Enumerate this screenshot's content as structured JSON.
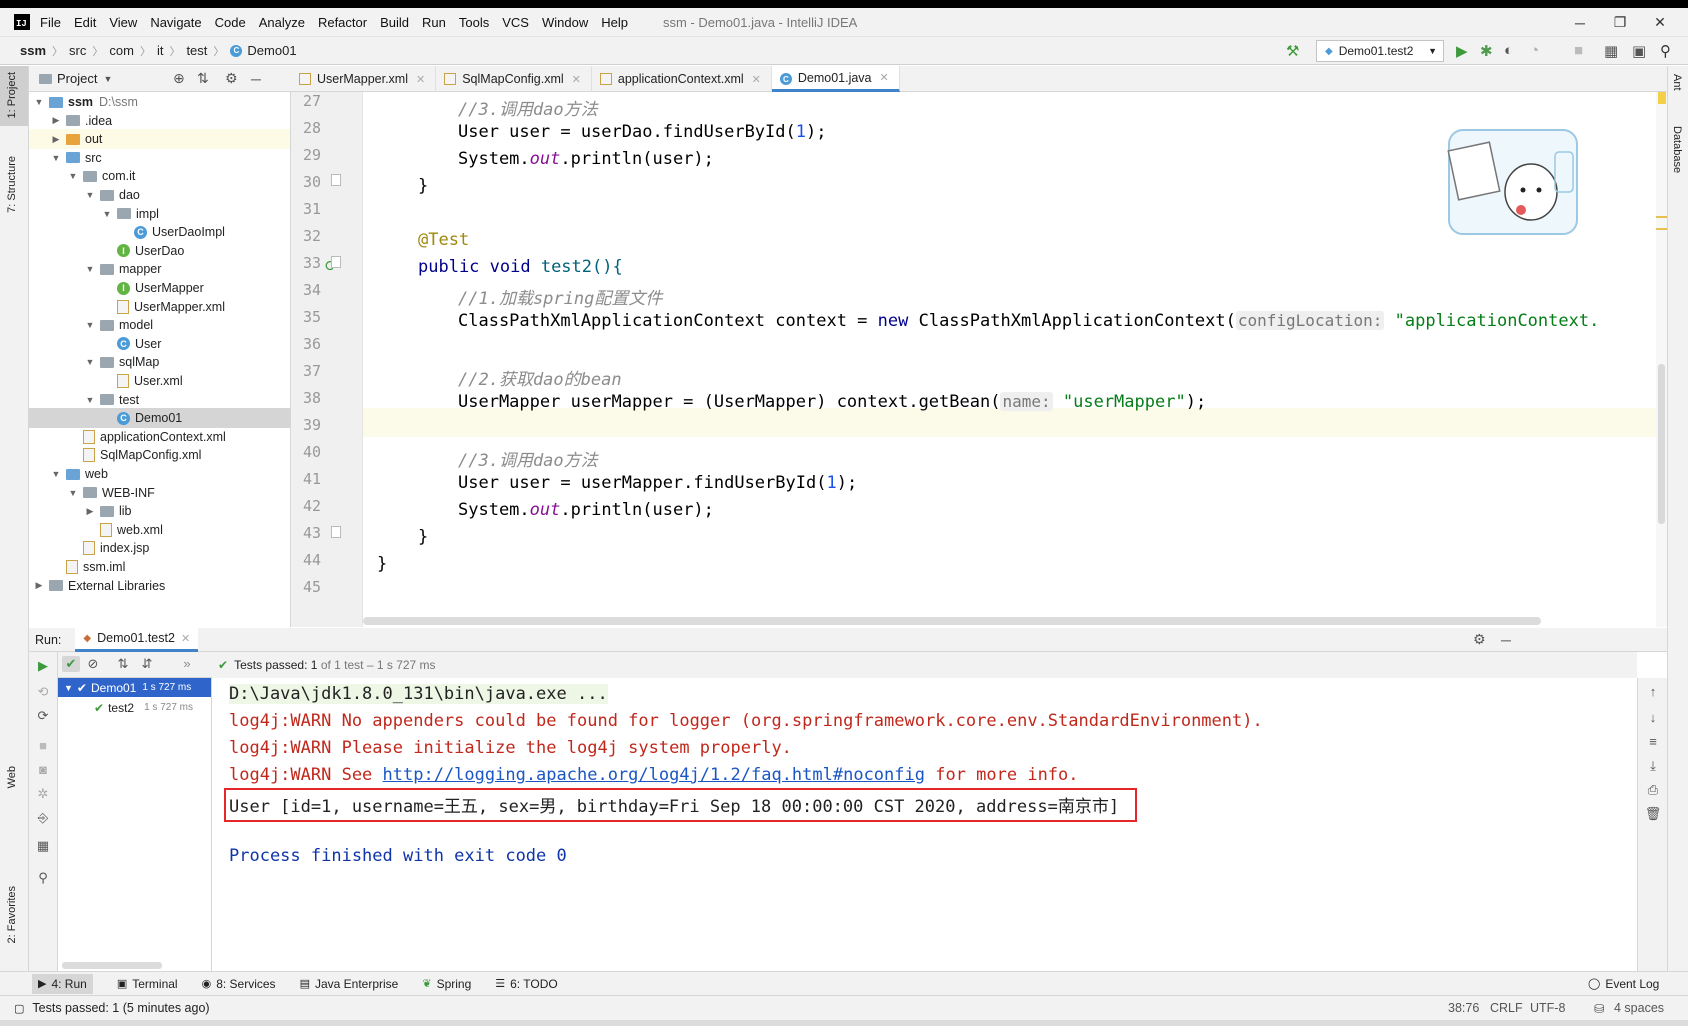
{
  "window": {
    "title": "ssm - Demo01.java - IntelliJ IDEA",
    "logo": "IJ"
  },
  "menu": [
    "File",
    "Edit",
    "View",
    "Navigate",
    "Code",
    "Analyze",
    "Refactor",
    "Build",
    "Run",
    "Tools",
    "VCS",
    "Window",
    "Help"
  ],
  "breadcrumb": [
    "ssm",
    "src",
    "com",
    "it",
    "test",
    "Demo01"
  ],
  "run_config": "Demo01.test2",
  "left_tool_tabs": [
    "1: Project",
    "7: Structure",
    "Web",
    "2: Favorites"
  ],
  "right_tool_tabs": [
    "Ant",
    "Database"
  ],
  "project_panel": {
    "title": "Project",
    "tree": [
      {
        "label": "ssm",
        "extra": "D:\\ssm",
        "depth": 0,
        "arrow": "▼",
        "icon": "folder-blue",
        "bold": true
      },
      {
        "label": ".idea",
        "depth": 1,
        "arrow": "▶",
        "icon": "folder"
      },
      {
        "label": "out",
        "depth": 1,
        "arrow": "▶",
        "icon": "folder-orange",
        "highlight": true
      },
      {
        "label": "src",
        "depth": 1,
        "arrow": "▼",
        "icon": "folder-blue"
      },
      {
        "label": "com.it",
        "depth": 2,
        "arrow": "▼",
        "icon": "folder"
      },
      {
        "label": "dao",
        "depth": 3,
        "arrow": "▼",
        "icon": "folder"
      },
      {
        "label": "impl",
        "depth": 4,
        "arrow": "▼",
        "icon": "folder"
      },
      {
        "label": "UserDaoImpl",
        "depth": 5,
        "arrow": "",
        "icon": "class"
      },
      {
        "label": "UserDao",
        "depth": 4,
        "arrow": "",
        "icon": "interface"
      },
      {
        "label": "mapper",
        "depth": 3,
        "arrow": "▼",
        "icon": "folder"
      },
      {
        "label": "UserMapper",
        "depth": 4,
        "arrow": "",
        "icon": "interface"
      },
      {
        "label": "UserMapper.xml",
        "depth": 4,
        "arrow": "",
        "icon": "xml"
      },
      {
        "label": "model",
        "depth": 3,
        "arrow": "▼",
        "icon": "folder"
      },
      {
        "label": "User",
        "depth": 4,
        "arrow": "",
        "icon": "class"
      },
      {
        "label": "sqlMap",
        "depth": 3,
        "arrow": "▼",
        "icon": "folder"
      },
      {
        "label": "User.xml",
        "depth": 4,
        "arrow": "",
        "icon": "xml"
      },
      {
        "label": "test",
        "depth": 3,
        "arrow": "▼",
        "icon": "folder"
      },
      {
        "label": "Demo01",
        "depth": 4,
        "arrow": "",
        "icon": "class",
        "selected": true
      },
      {
        "label": "applicationContext.xml",
        "depth": 2,
        "arrow": "",
        "icon": "xml"
      },
      {
        "label": "SqlMapConfig.xml",
        "depth": 2,
        "arrow": "",
        "icon": "xml"
      },
      {
        "label": "web",
        "depth": 1,
        "arrow": "▼",
        "icon": "folder-blue"
      },
      {
        "label": "WEB-INF",
        "depth": 2,
        "arrow": "▼",
        "icon": "folder"
      },
      {
        "label": "lib",
        "depth": 3,
        "arrow": "▶",
        "icon": "folder"
      },
      {
        "label": "web.xml",
        "depth": 3,
        "arrow": "",
        "icon": "xml"
      },
      {
        "label": "index.jsp",
        "depth": 2,
        "arrow": "",
        "icon": "xml"
      },
      {
        "label": "ssm.iml",
        "depth": 1,
        "arrow": "",
        "icon": "xml"
      },
      {
        "label": "External Libraries",
        "depth": 0,
        "arrow": "▶",
        "icon": "folder"
      }
    ]
  },
  "editor_tabs": [
    {
      "label": "UserMapper.xml",
      "icon": "xml"
    },
    {
      "label": "SqlMapConfig.xml",
      "icon": "xml"
    },
    {
      "label": "applicationContext.xml",
      "icon": "xml"
    },
    {
      "label": "Demo01.java",
      "icon": "class",
      "active": true
    }
  ],
  "code": {
    "line_numbers": [
      "27",
      "28",
      "29",
      "30",
      "31",
      "32",
      "33",
      "34",
      "35",
      "36",
      "37",
      "38",
      "39",
      "40",
      "41",
      "42",
      "43",
      "44",
      "45"
    ],
    "l27": "//3.调用dao方法",
    "l28_a": "User user = userDao.findUserById(",
    "l28_n": "1",
    "l28_b": ");",
    "l29_a": "System.",
    "l29_f": "out",
    "l29_b": ".println(user);",
    "l30": "}",
    "l32": "@Test",
    "l33_k": "public void",
    "l33_b": " test2(){",
    "l34": "//1.加载spring配置文件",
    "l35_a": "ClassPathXmlApplicationContext context = ",
    "l35_k": "new",
    "l35_b": " ClassPathXmlApplicationContext(",
    "l35_hint": "configLocation:",
    "l35_s": "\"applicationContext.",
    "l37": "//2.获取dao的bean",
    "l38_a": "UserMapper userMapper = (UserMapper) context.getBean(",
    "l38_hint": "name:",
    "l38_s": "\"userMapper\"",
    "l38_b": ");",
    "l40": "//3.调用dao方法",
    "l41_a": "User user = userMapper.findUserById(",
    "l41_n": "1",
    "l41_b": ");",
    "l42_a": "System.",
    "l42_f": "out",
    "l42_b": ".println(user);",
    "l43": "}",
    "l44": "}"
  },
  "run_panel": {
    "label": "Run:",
    "tab": "Demo01.test2",
    "status_prefix": "Tests passed:",
    "status_count": "1",
    "status_suffix": "of 1 test – 1 s 727 ms",
    "tree": [
      {
        "label": "Demo01",
        "time": "1 s 727 ms",
        "selected": true
      },
      {
        "label": "test2",
        "time": "1 s 727 ms"
      }
    ],
    "console": {
      "l1": "D:\\Java\\jdk1.8.0_131\\bin\\java.exe ...",
      "l2": "log4j:WARN No appenders could be found for logger (org.springframework.core.env.StandardEnvironment).",
      "l3": "log4j:WARN Please initialize the log4j system properly.",
      "l4_a": "log4j:WARN See ",
      "l4_link": "http://logging.apache.org/log4j/1.2/faq.html#noconfig",
      "l4_b": " for more info.",
      "l5": "User [id=1, username=王五, sex=男, birthday=Fri Sep 18 00:00:00 CST 2020, address=南京市]",
      "l6": "Process finished with exit code 0"
    }
  },
  "bottom_tabs": [
    "4: Run",
    "Terminal",
    "8: Services",
    "Java Enterprise",
    "Spring",
    "6: TODO"
  ],
  "event_log": "Event Log",
  "status": {
    "message": "Tests passed: 1 (5 minutes ago)",
    "position": "38:76",
    "line_sep": "CRLF",
    "encoding": "UTF-8",
    "indent": "4 spaces"
  }
}
